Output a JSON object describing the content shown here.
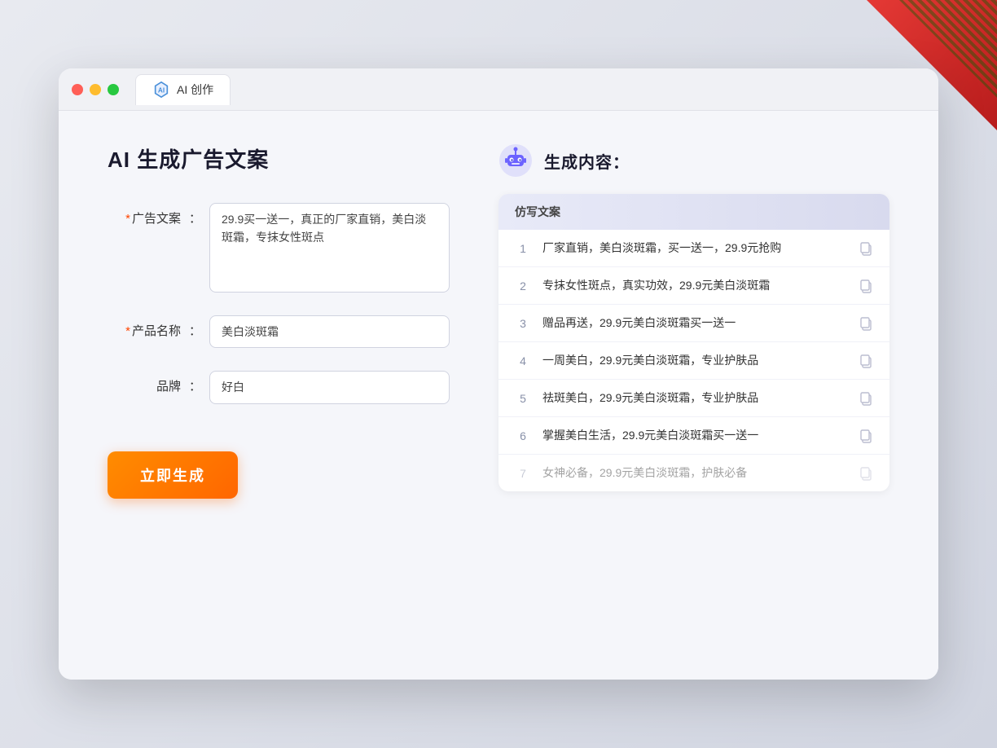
{
  "window": {
    "tab_label": "AI 创作",
    "traffic": [
      "red",
      "yellow",
      "green"
    ]
  },
  "left": {
    "title": "AI 生成广告文案",
    "form": {
      "ad_copy_label": "广告文案",
      "ad_copy_required": "*",
      "ad_copy_value": "29.9买一送一，真正的厂家直销，美白淡斑霜，专抹女性斑点",
      "product_label": "产品名称",
      "product_required": "*",
      "product_value": "美白淡斑霜",
      "brand_label": "品牌",
      "brand_value": "好白"
    },
    "generate_btn": "立即生成"
  },
  "right": {
    "title": "生成内容：",
    "table_header": "仿写文案",
    "rows": [
      {
        "num": "1",
        "text": "厂家直销，美白淡斑霜，买一送一，29.9元抢购",
        "faded": false
      },
      {
        "num": "2",
        "text": "专抹女性斑点，真实功效，29.9元美白淡斑霜",
        "faded": false
      },
      {
        "num": "3",
        "text": "赠品再送，29.9元美白淡斑霜买一送一",
        "faded": false
      },
      {
        "num": "4",
        "text": "一周美白，29.9元美白淡斑霜，专业护肤品",
        "faded": false
      },
      {
        "num": "5",
        "text": "祛斑美白，29.9元美白淡斑霜，专业护肤品",
        "faded": false
      },
      {
        "num": "6",
        "text": "掌握美白生活，29.9元美白淡斑霜买一送一",
        "faded": false
      },
      {
        "num": "7",
        "text": "女神必备，29.9元美白淡斑霜，护肤必备",
        "faded": true
      }
    ]
  }
}
